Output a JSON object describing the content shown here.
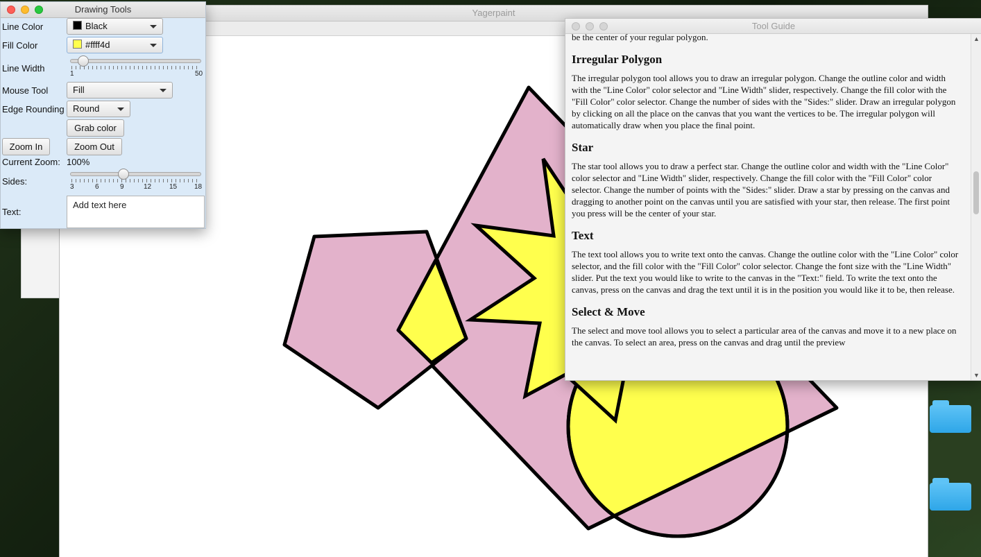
{
  "main_window": {
    "title": "Yagerpaint"
  },
  "drawing_tools": {
    "title": "Drawing Tools",
    "line_color": {
      "label": "Line Color",
      "value": "Black",
      "swatch": "#000000"
    },
    "fill_color": {
      "label": "Fill Color",
      "value": "#ffff4d",
      "swatch": "#ffff4d"
    },
    "line_width": {
      "label": "Line Width",
      "min": "1",
      "max": "50",
      "value": 3
    },
    "mouse_tool": {
      "label": "Mouse Tool",
      "value": "Fill"
    },
    "edge_rounding": {
      "label": "Edge Rounding",
      "value": "Round"
    },
    "grab_color": "Grab color",
    "zoom_in": "Zoom In",
    "zoom_out": "Zoom Out",
    "current_zoom_label": "Current Zoom:",
    "current_zoom_value": "100%",
    "sides": {
      "label": "Sides:",
      "ticks": [
        "3",
        "6",
        "9",
        "12",
        "15",
        "18"
      ],
      "value": 9
    },
    "text": {
      "label": "Text:",
      "value": "Add text here"
    }
  },
  "tool_guide": {
    "title": "Tool Guide",
    "intro_tail": "be the center of your regular polygon.",
    "sections": [
      {
        "heading": "Irregular Polygon",
        "body": "The irregular polygon tool allows you to draw an irregular polygon. Change the outline color and width with the \"Line Color\" color selector and \"Line Width\" slider, respectively. Change the fill color with the \"Fill Color\" color selector. Change the number of sides with the \"Sides:\" slider. Draw an irregular polygon by clicking on all the place on the canvas that you want the vertices to be. The irregular polygon will automatically draw when you place the final point."
      },
      {
        "heading": "Star",
        "body": "The star tool allows you to draw a perfect star. Change the outline color and width with the \"Line Color\" color selector and \"Line Width\" slider, respectively. Change the fill color with the \"Fill Color\" color selector. Change the number of points with the \"Sides:\" slider. Draw a star by pressing on the canvas and dragging to another point on the canvas until you are satisfied with your star, then release. The first point you press will be the center of your star."
      },
      {
        "heading": "Text",
        "body": "The text tool allows you to write text onto the canvas. Change the outline color with the \"Line Color\" color selector, and the fill color with the \"Fill Color\" color selector. Change the font size with the \"Line Width\" slider. Put the text you would like to write to the canvas in the \"Text:\" field. To write the text onto the canvas, press on the canvas and drag the text until it is in the position you would like it to be, then release."
      },
      {
        "heading": "Select & Move",
        "body": "The select and move tool allows you to select a particular area of the canvas and move it to a new place on the canvas. To select an area, press on the canvas and drag until the preview"
      }
    ]
  },
  "colors": {
    "pink_fill": "#e3b2cb",
    "yellow_fill": "#ffff4d",
    "stroke": "#000000"
  }
}
